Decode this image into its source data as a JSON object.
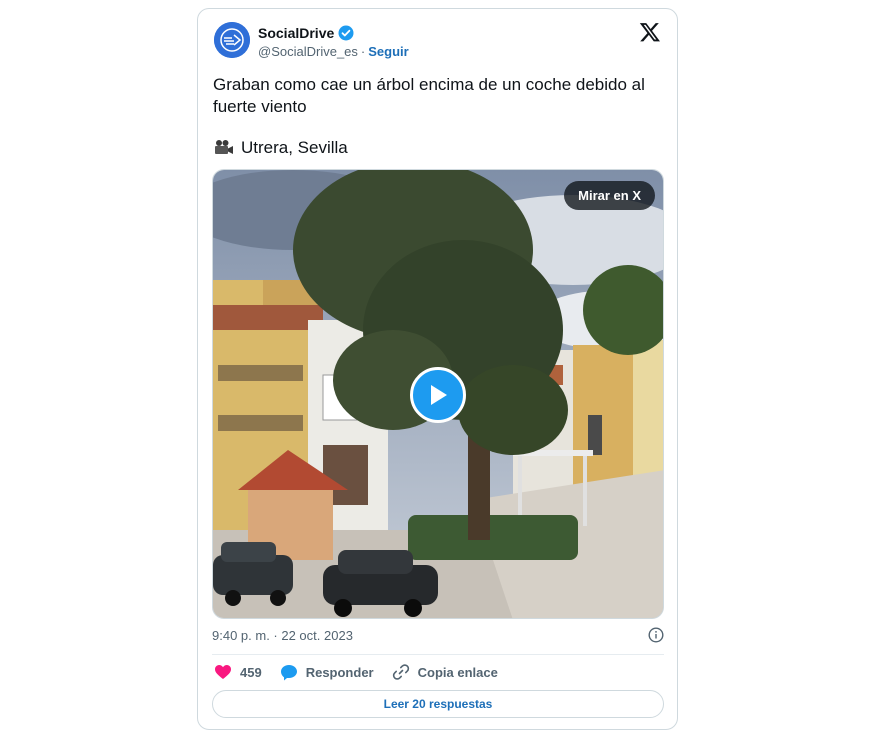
{
  "author": {
    "display_name": "SocialDrive",
    "handle": "@SocialDrive_es",
    "separator": "·",
    "follow_label": "Seguir",
    "verified": true
  },
  "tweet": {
    "text": "Graban como cae un árbol encima de un coche debido al fuerte viento",
    "location_icon": "video-camera-icon",
    "location": "Utrera, Sevilla"
  },
  "media": {
    "watch_label": "Mirar en X",
    "play_icon": "play-icon"
  },
  "meta": {
    "timestamp": "9:40 p. m. · 22 oct. 2023",
    "info_icon": "info-icon"
  },
  "actions": {
    "like_count": "459",
    "reply_label": "Responder",
    "copy_link_label": "Copia enlace"
  },
  "read_replies_label": "Leer 20 respuestas",
  "colors": {
    "accent": "#1d9bf0",
    "link": "#1d6fb8",
    "like": "#f91880",
    "muted": "#536471"
  }
}
